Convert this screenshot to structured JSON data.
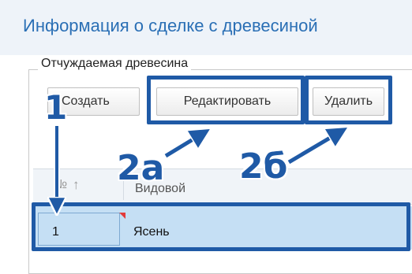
{
  "header": {
    "title": "Информация о сделке с древесиной"
  },
  "section": {
    "legend": "Отчуждаемая древесина"
  },
  "toolbar": {
    "create_label": "Создать",
    "edit_label": "Редактировать",
    "delete_label": "Удалить"
  },
  "grid": {
    "columns": [
      {
        "label": "№",
        "sort_icon": "arrow-up-icon"
      },
      {
        "label": "Видовой"
      }
    ],
    "rows": [
      {
        "num": "1",
        "species": "Ясень"
      }
    ]
  },
  "annotations": {
    "step1": "1",
    "step2a": "2а",
    "step2b": "2б"
  },
  "colors": {
    "title": "#2a6fb5",
    "highlight": "#1f5aa6",
    "selected_row": "#c5dff4"
  }
}
